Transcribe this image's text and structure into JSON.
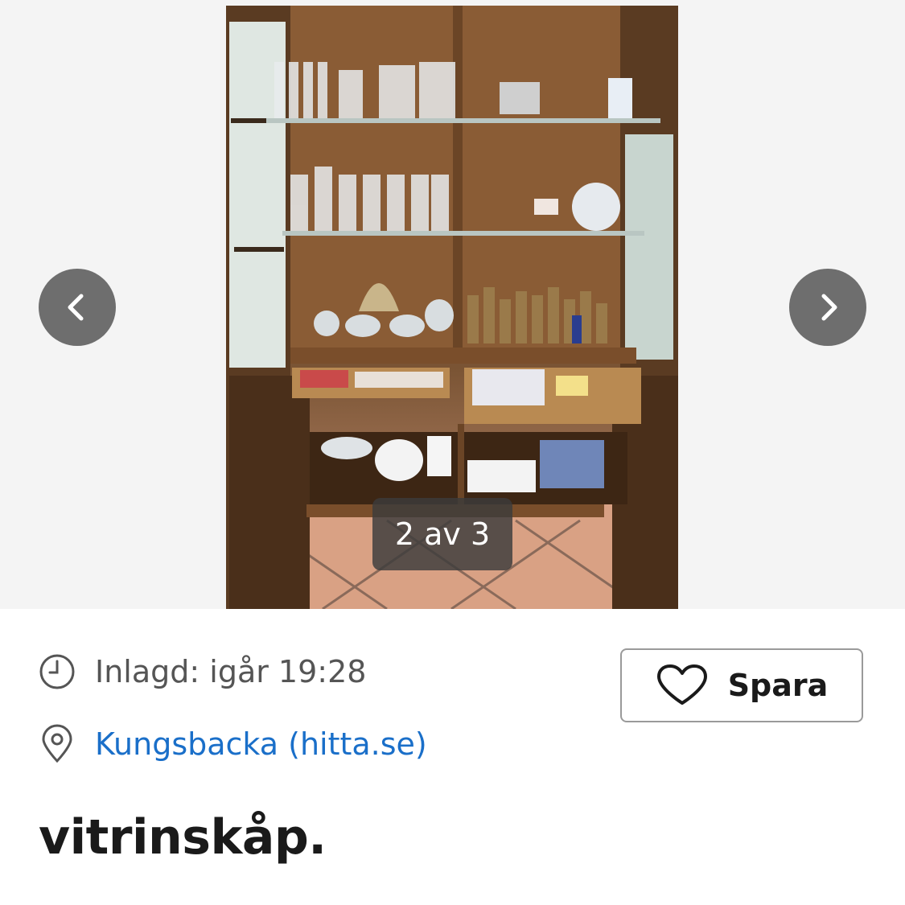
{
  "gallery": {
    "counter": "2 av 3",
    "image_alt": "vitrinskåp"
  },
  "meta": {
    "posted": "Inlagd: igår 19:28",
    "location": "Kungsbacka (hitta.se)"
  },
  "actions": {
    "save_label": "Spara"
  },
  "listing": {
    "title": "vitrinskåp."
  },
  "icons": {
    "prev": "chevron-left-icon",
    "next": "chevron-right-icon",
    "clock": "clock-icon",
    "location": "map-pin-icon",
    "heart": "heart-icon"
  },
  "colors": {
    "link": "#1a6fc9",
    "nav_button": "#6e6e6e",
    "background": "#f4f4f4"
  }
}
